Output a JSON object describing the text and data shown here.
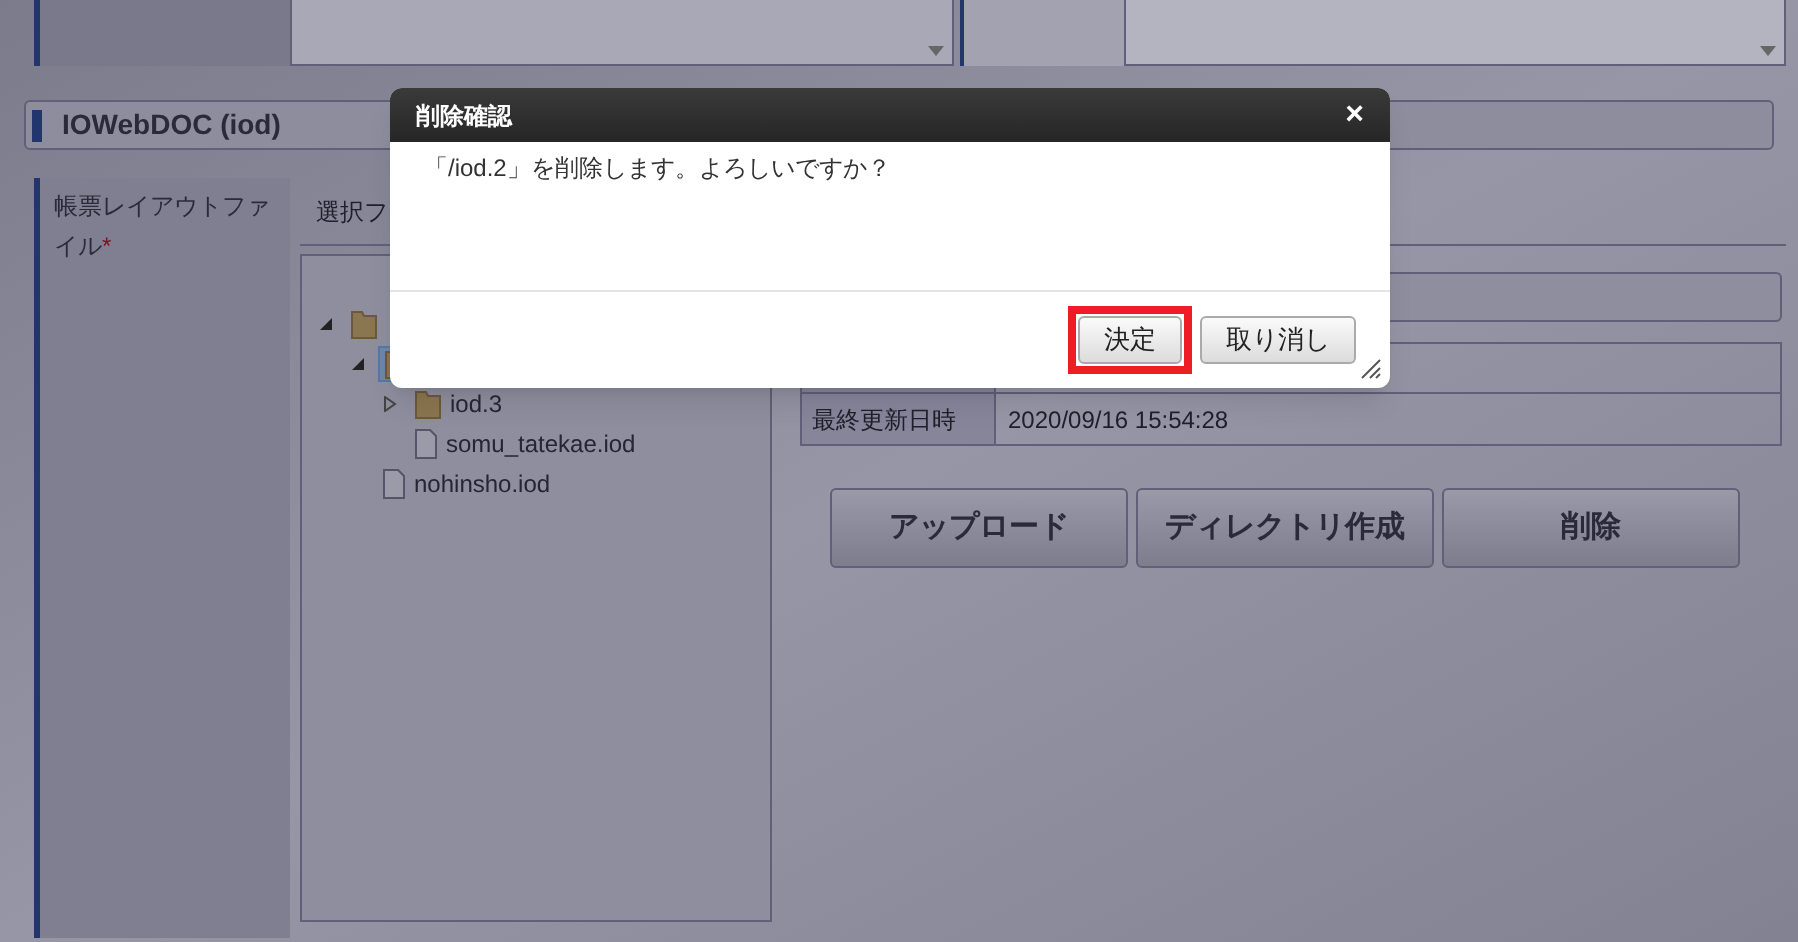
{
  "section": {
    "title": "IOWebDOC (iod)"
  },
  "form": {
    "label": "帳票レイアウトファイル",
    "required_mark": "*",
    "panel_title": "選択フ",
    "tree": [
      {
        "kind": "folder",
        "expanded": true,
        "selected": false,
        "children": [
          {
            "kind": "folder",
            "expanded": true,
            "selected": true,
            "children": [
              {
                "kind": "folder",
                "label": "iod.3",
                "expanded": false,
                "selected": false
              },
              {
                "kind": "file",
                "label": "somu_tatekae.iod",
                "selected": false
              }
            ]
          },
          {
            "kind": "file",
            "label": "nohinsho.iod",
            "selected": false
          }
        ]
      }
    ],
    "details": [
      {
        "label": "最終更新日時",
        "value": "2020/09/16 15:54:28"
      }
    ],
    "buttons": [
      "アップロード",
      "ディレクトリ作成",
      "削除"
    ]
  },
  "dialog": {
    "title": "削除確認",
    "close": "×",
    "message": "「/iod.2」を削除します。よろしいですか？",
    "buttons": [
      {
        "label": "決定",
        "highlighted": true
      },
      {
        "label": "取り消し",
        "highlighted": false
      }
    ]
  }
}
